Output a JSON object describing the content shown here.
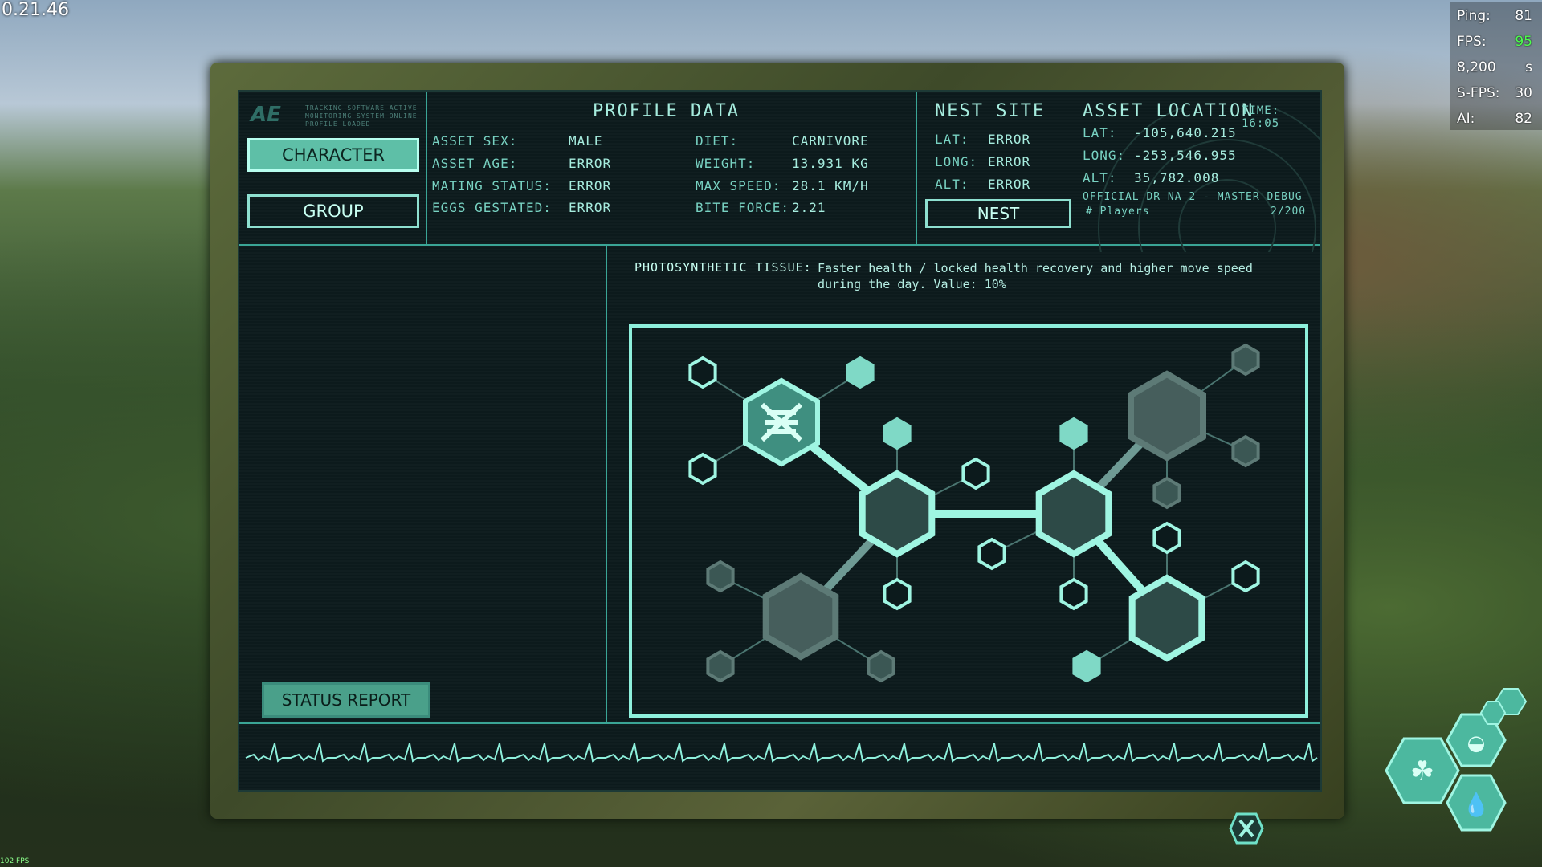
{
  "version": "0.21.46",
  "tiny_fps": "102 FPS",
  "stats": [
    {
      "label": "Ping:",
      "value": "81",
      "color": "#ffffff"
    },
    {
      "label": "FPS:",
      "value": "95",
      "color": "#4cff4c"
    },
    {
      "label": "8,200",
      "value": "s",
      "color": "#ffffff"
    },
    {
      "label": "S-FPS:",
      "value": "30",
      "color": "#ffffff"
    },
    {
      "label": "AI:",
      "value": "82",
      "color": "#ffffff"
    }
  ],
  "logo": {
    "text": "AE",
    "lines": [
      "TRACKING SOFTWARE ACTIVE",
      "MONITORING SYSTEM ONLINE",
      "PROFILE LOADED"
    ]
  },
  "nav": {
    "character": "CHARACTER",
    "group": "GROUP"
  },
  "profile": {
    "title": "PROFILE DATA",
    "left": [
      {
        "label": "ASSET SEX:",
        "value": "MALE"
      },
      {
        "label": "ASSET AGE:",
        "value": "ERROR"
      },
      {
        "label": "MATING STATUS:",
        "value": "ERROR"
      },
      {
        "label": "EGGS GESTATED:",
        "value": "ERROR"
      }
    ],
    "right": [
      {
        "label": "DIET:",
        "value": "CARNIVORE"
      },
      {
        "label": "WEIGHT:",
        "value": "13.931 KG"
      },
      {
        "label": "MAX SPEED:",
        "value": "28.1 KM/H"
      },
      {
        "label": "BITE FORCE:",
        "value": "2.21"
      }
    ]
  },
  "nest": {
    "title": "NEST SITE",
    "rows": [
      {
        "label": "LAT:",
        "value": "ERROR"
      },
      {
        "label": "LONG:",
        "value": "ERROR"
      },
      {
        "label": "ALT:",
        "value": "ERROR"
      }
    ],
    "button": "NEST"
  },
  "location": {
    "title": "ASSET LOCATION",
    "time": "TIME: 16:05",
    "rows": [
      {
        "label": "LAT:",
        "value": "-105,640.215"
      },
      {
        "label": "LONG:",
        "value": "-253,546.955"
      },
      {
        "label": "ALT:",
        "value": "35,782.008"
      }
    ],
    "server": "OFFICIAL DR NA 2 - MASTER DEBUG",
    "players_label": "# Players",
    "players": "2/200"
  },
  "trait": {
    "name": "PHOTOSYNTHETIC TISSUE:",
    "desc1": "Faster health / locked health recovery and higher move speed",
    "desc2": "during the day. Value: 10%"
  },
  "status_report": "STATUS REPORT",
  "colors": {
    "accent": "#8ef0dc",
    "screen": "#0c1a1c",
    "frame": "#4e5a33",
    "hex_big": "#2e4a48",
    "hex_dim": "#3b5754"
  }
}
